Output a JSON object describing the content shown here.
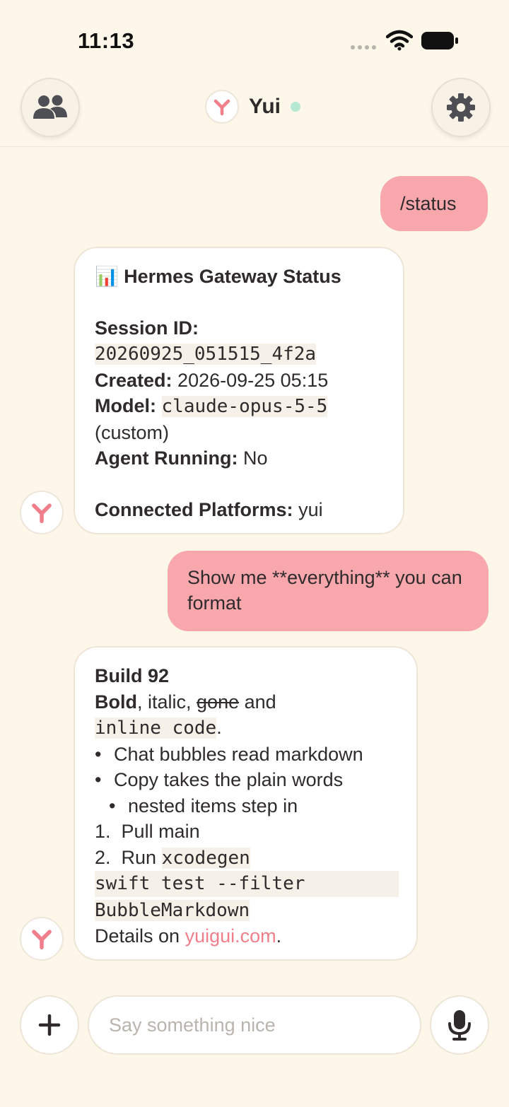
{
  "status_bar": {
    "time": "11:13"
  },
  "header": {
    "title": "Yui"
  },
  "messages": {
    "user1": "/status",
    "status": {
      "emoji": "📊",
      "title": "Hermes Gateway Status",
      "session_label": "Session ID:",
      "session_value": "20260925_051515_4f2a",
      "created_label": "Created:",
      "created_value": "2026-09-25 05:15",
      "model_label": "Model:",
      "model_value": "claude-opus-5-5",
      "model_note": "(custom)",
      "agent_label": "Agent Running:",
      "agent_value": "No",
      "platforms_label": "Connected Platforms:",
      "platforms_value": "yui"
    },
    "user2": "Show me **everything** you can format",
    "format": {
      "heading": "Build 92",
      "bold": "Bold",
      "after_bold": ", italic, ",
      "strike": "gone",
      "after_strike": " and",
      "code": "inline code",
      "after_code": ".",
      "bullets": [
        "Chat bubbles read markdown",
        "Copy takes the plain words"
      ],
      "nested": [
        "nested items step in"
      ],
      "numbered": [
        {
          "num": "1.",
          "text": "Pull main",
          "code": ""
        },
        {
          "num": "2.",
          "text": "Run ",
          "code": "xcodegen"
        }
      ],
      "codeblock": [
        "swift test --filter",
        "BubbleMarkdown"
      ],
      "details_prefix": "Details on ",
      "link": "yuigui.com",
      "details_suffix": "."
    }
  },
  "composer": {
    "placeholder": "Say something nice"
  },
  "colors": {
    "background": "#fdf7ea",
    "user_bubble": "#f8a7ad",
    "accent": "#f07f8b",
    "online": "#b6e8d3"
  },
  "icons": [
    "people-icon",
    "gear-icon",
    "yui-logo-icon",
    "plus-icon",
    "microphone-icon",
    "wifi-icon",
    "battery-icon"
  ]
}
